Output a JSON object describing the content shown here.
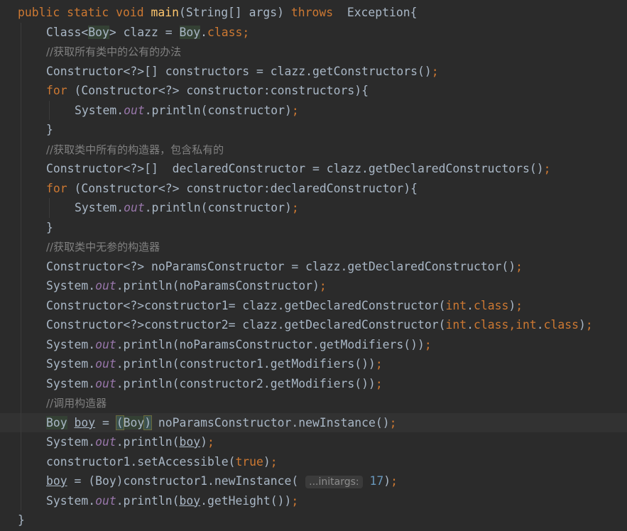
{
  "editor": {
    "lines": [
      {
        "indent": 0,
        "tokens": [
          {
            "t": "public static void ",
            "c": "kw"
          },
          {
            "t": "main",
            "c": "fn"
          },
          {
            "t": "(String[] args) "
          },
          {
            "t": "throws ",
            "c": "kw"
          },
          {
            "t": " Exception{"
          }
        ]
      },
      {
        "indent": 1,
        "tokens": [
          {
            "t": "Class<"
          },
          {
            "t": "Boy",
            "c": "typehl"
          },
          {
            "t": "> clazz = "
          },
          {
            "t": "Boy",
            "c": "typehl"
          },
          {
            "t": "."
          },
          {
            "t": "class",
            "c": "kw"
          },
          {
            "t": ";",
            "c": "kw"
          }
        ]
      },
      {
        "indent": 1,
        "tokens": [
          {
            "t": "//获取所有类中的公有的办法",
            "c": "cmt"
          }
        ]
      },
      {
        "indent": 1,
        "tokens": [
          {
            "t": "Constructor<?>[] constructors = clazz.getConstructors()"
          },
          {
            "t": ";",
            "c": "kw"
          }
        ]
      },
      {
        "indent": 1,
        "tokens": [
          {
            "t": "for ",
            "c": "kw"
          },
          {
            "t": "(Constructor<?> constructor:constructors){"
          }
        ]
      },
      {
        "indent": 2,
        "tokens": [
          {
            "t": "System."
          },
          {
            "t": "out",
            "c": "field"
          },
          {
            "t": ".println(constructor)"
          },
          {
            "t": ";",
            "c": "kw"
          }
        ]
      },
      {
        "indent": 1,
        "tokens": [
          {
            "t": "}"
          }
        ]
      },
      {
        "indent": 1,
        "tokens": [
          {
            "t": "//获取类中所有的构造器，包含私有的",
            "c": "cmt"
          }
        ]
      },
      {
        "indent": 1,
        "tokens": [
          {
            "t": "Constructor<?>[]  declaredConstructor = clazz.getDeclaredConstructors()"
          },
          {
            "t": ";",
            "c": "kw"
          }
        ]
      },
      {
        "indent": 1,
        "tokens": [
          {
            "t": "for ",
            "c": "kw"
          },
          {
            "t": "(Constructor<?> constructor:declaredConstructor){"
          }
        ]
      },
      {
        "indent": 2,
        "tokens": [
          {
            "t": "System."
          },
          {
            "t": "out",
            "c": "field"
          },
          {
            "t": ".println(constructor)"
          },
          {
            "t": ";",
            "c": "kw"
          }
        ]
      },
      {
        "indent": 1,
        "tokens": [
          {
            "t": "}"
          }
        ]
      },
      {
        "indent": 1,
        "tokens": [
          {
            "t": "//获取类中无参的构造器",
            "c": "cmt"
          }
        ]
      },
      {
        "indent": 1,
        "tokens": [
          {
            "t": "Constructor<?> noParamsConstructor = clazz.getDeclaredConstructor()"
          },
          {
            "t": ";",
            "c": "kw"
          }
        ]
      },
      {
        "indent": 1,
        "tokens": [
          {
            "t": "System."
          },
          {
            "t": "out",
            "c": "field"
          },
          {
            "t": ".println(noParamsConstructor)"
          },
          {
            "t": ";",
            "c": "kw"
          }
        ]
      },
      {
        "indent": 1,
        "tokens": [
          {
            "t": "Constructor<?>constructor1= clazz.getDeclaredConstructor("
          },
          {
            "t": "int",
            "c": "kw"
          },
          {
            "t": "."
          },
          {
            "t": "class",
            "c": "kw"
          },
          {
            "t": ")"
          },
          {
            "t": ";",
            "c": "kw"
          }
        ]
      },
      {
        "indent": 1,
        "tokens": [
          {
            "t": "Constructor<?>constructor2= clazz.getDeclaredConstructor("
          },
          {
            "t": "int",
            "c": "kw"
          },
          {
            "t": "."
          },
          {
            "t": "class",
            "c": "kw"
          },
          {
            "t": ",",
            "c": "kw"
          },
          {
            "t": "int",
            "c": "kw"
          },
          {
            "t": "."
          },
          {
            "t": "class",
            "c": "kw"
          },
          {
            "t": ")"
          },
          {
            "t": ";",
            "c": "kw"
          }
        ]
      },
      {
        "indent": 1,
        "tokens": [
          {
            "t": "System."
          },
          {
            "t": "out",
            "c": "field"
          },
          {
            "t": ".println(noParamsConstructor.getModifiers())"
          },
          {
            "t": ";",
            "c": "kw"
          }
        ]
      },
      {
        "indent": 1,
        "tokens": [
          {
            "t": "System."
          },
          {
            "t": "out",
            "c": "field"
          },
          {
            "t": ".println(constructor1.getModifiers())"
          },
          {
            "t": ";",
            "c": "kw"
          }
        ]
      },
      {
        "indent": 1,
        "tokens": [
          {
            "t": "System."
          },
          {
            "t": "out",
            "c": "field"
          },
          {
            "t": ".println(constructor2.getModifiers())"
          },
          {
            "t": ";",
            "c": "kw"
          }
        ]
      },
      {
        "indent": 1,
        "tokens": [
          {
            "t": "//调用构造器",
            "c": "cmt"
          }
        ]
      },
      {
        "indent": 1,
        "current": true,
        "tokens": [
          {
            "t": "Boy",
            "c": "typehl"
          },
          {
            "t": " "
          },
          {
            "t": "boy",
            "c": "ul"
          },
          {
            "t": " = "
          },
          {
            "t": "(",
            "c": "brace-match"
          },
          {
            "t": "Boy",
            "c": "typehl"
          },
          {
            "t": "",
            "c": "caret"
          },
          {
            "t": ")",
            "c": "brace-match"
          },
          {
            "t": " noParamsConstructor.newInstance()"
          },
          {
            "t": ";",
            "c": "kw"
          }
        ]
      },
      {
        "indent": 1,
        "tokens": [
          {
            "t": "System."
          },
          {
            "t": "out",
            "c": "field"
          },
          {
            "t": ".println("
          },
          {
            "t": "boy",
            "c": "ul"
          },
          {
            "t": ")"
          },
          {
            "t": ";",
            "c": "kw"
          }
        ]
      },
      {
        "indent": 1,
        "tokens": [
          {
            "t": "constructor1.setAccessible("
          },
          {
            "t": "true",
            "c": "kw"
          },
          {
            "t": ")"
          },
          {
            "t": ";",
            "c": "kw"
          }
        ]
      },
      {
        "indent": 1,
        "tokens": [
          {
            "t": "boy",
            "c": "ul"
          },
          {
            "t": " = (Boy)constructor1.newInstance( "
          },
          {
            "t": "...initargs:",
            "c": "hint"
          },
          {
            "t": " "
          },
          {
            "t": "17",
            "c": "num"
          },
          {
            "t": ")"
          },
          {
            "t": ";",
            "c": "kw"
          }
        ]
      },
      {
        "indent": 1,
        "tokens": [
          {
            "t": "System."
          },
          {
            "t": "out",
            "c": "field"
          },
          {
            "t": ".println("
          },
          {
            "t": "boy",
            "c": "ul"
          },
          {
            "t": ".getHeight())"
          },
          {
            "t": ";",
            "c": "kw"
          }
        ]
      },
      {
        "indent": 0,
        "tokens": [
          {
            "t": "}"
          }
        ]
      }
    ]
  }
}
